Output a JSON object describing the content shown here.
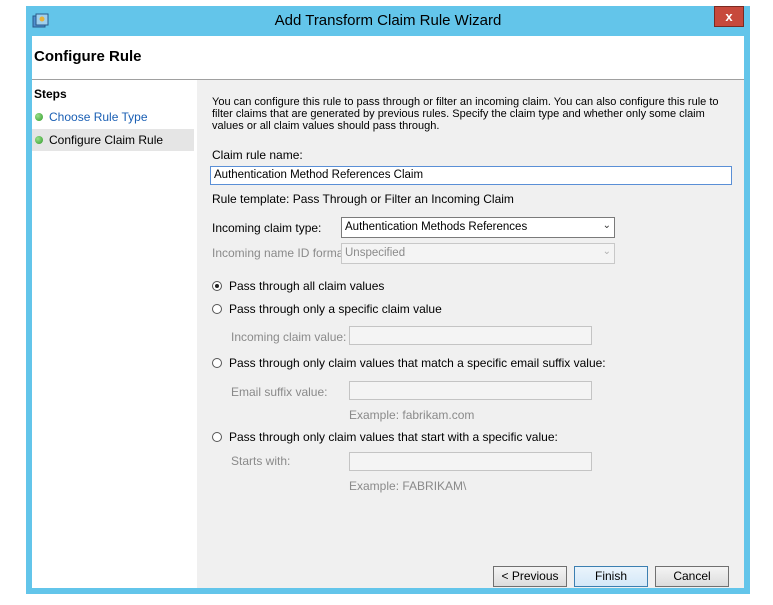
{
  "window": {
    "title": "Add Transform Claim Rule Wizard",
    "close_label": "x"
  },
  "header": {
    "title": "Configure Rule"
  },
  "steps": {
    "title": "Steps",
    "items": [
      {
        "label": "Choose Rule Type"
      },
      {
        "label": "Configure Claim Rule"
      }
    ]
  },
  "form": {
    "description": "You can configure this rule to pass through or filter an incoming claim. You can also configure this rule to filter claims that are generated by previous rules. Specify the claim type and whether only some claim values or all claim values should pass through.",
    "claim_rule_name": {
      "label": "Claim rule name:",
      "value": "Authentication Method References Claim"
    },
    "rule_template": "Rule template: Pass Through or Filter an Incoming Claim",
    "incoming_claim_type": {
      "label": "Incoming claim type:",
      "value": "Authentication Methods References"
    },
    "incoming_name_id_format": {
      "label": "Incoming name ID format:",
      "value": "Unspecified"
    },
    "options": [
      {
        "label": "Pass through all claim values",
        "checked": true
      },
      {
        "label": "Pass through only a specific claim value",
        "checked": false
      },
      {
        "label": "Pass through only claim values that match a specific email suffix value:",
        "checked": false
      },
      {
        "label": "Pass through only claim values that start with a specific value:",
        "checked": false
      }
    ],
    "incoming_claim_value": {
      "label": "Incoming claim value:"
    },
    "email_suffix_value": {
      "label": "Email suffix value:",
      "example": "Example: fabrikam.com"
    },
    "starts_with": {
      "label": "Starts with:",
      "example": "Example: FABRIKAM\\"
    }
  },
  "buttons": {
    "previous": "< Previous",
    "finish": "Finish",
    "cancel": "Cancel"
  }
}
